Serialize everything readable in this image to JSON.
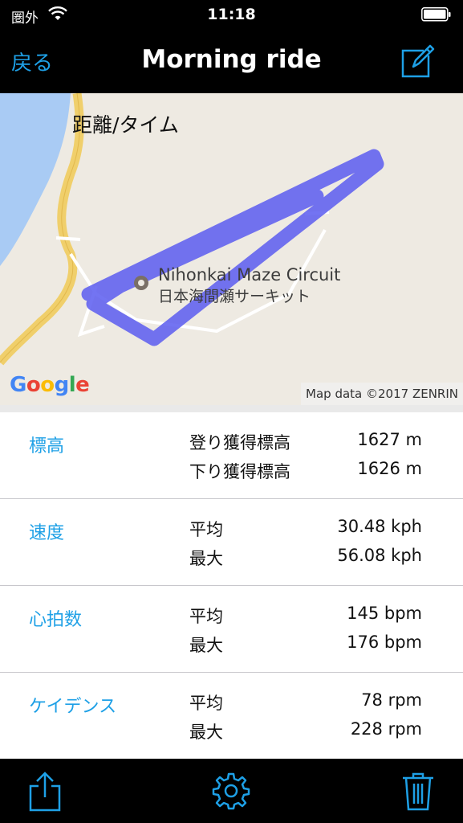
{
  "status": {
    "carrier": "圏外",
    "time": "11:18"
  },
  "nav": {
    "back_label": "戻る",
    "title": "Morning ride"
  },
  "map": {
    "label": "距離/タイム",
    "poi_name": "Nihonkai Maze Circuit",
    "poi_name_ja": "日本海間瀬サーキット",
    "logo": "Google",
    "attribution": "Map data ©2017 ZENRIN",
    "route_color": "#5b5cf0"
  },
  "stats": [
    {
      "category": "標高",
      "rows": [
        {
          "label": "登り獲得標高",
          "value": "1627 m"
        },
        {
          "label": "下り獲得標高",
          "value": "1626 m"
        }
      ]
    },
    {
      "category": "速度",
      "rows": [
        {
          "label": "平均",
          "value": "30.48 kph"
        },
        {
          "label": "最大",
          "value": "56.08 kph"
        }
      ]
    },
    {
      "category": "心拍数",
      "rows": [
        {
          "label": "平均",
          "value": "145 bpm"
        },
        {
          "label": "最大",
          "value": "176 bpm"
        }
      ]
    },
    {
      "category": "ケイデンス",
      "rows": [
        {
          "label": "平均",
          "value": "78 rpm"
        },
        {
          "label": "最大",
          "value": "228 rpm"
        }
      ]
    }
  ],
  "toolbar": {
    "icons": [
      "share-icon",
      "gear-icon",
      "trash-icon"
    ]
  },
  "colors": {
    "accent": "#1ea0e6",
    "bar": "#000000"
  }
}
